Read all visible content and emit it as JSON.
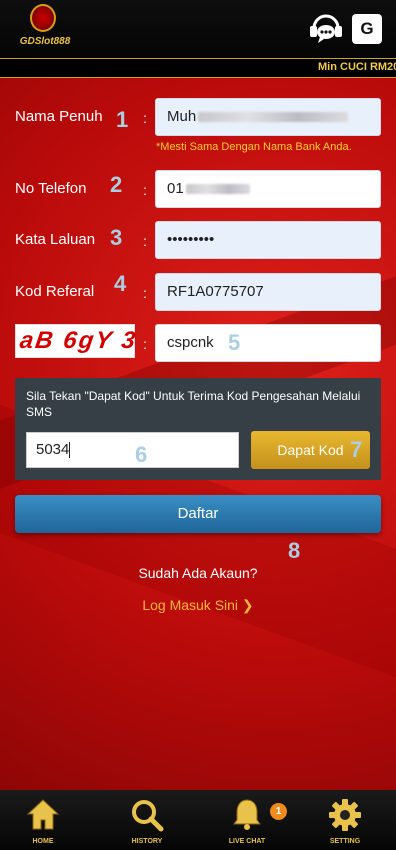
{
  "header": {
    "logo_text": "GDSlot888",
    "translate_label": "G",
    "ticker": "Min CUCI RM20"
  },
  "form": {
    "full_name": {
      "label": "Nama Penuh",
      "step": "1",
      "value": "Muh",
      "hint": "*Mesti Sama Dengan Nama Bank Anda."
    },
    "phone": {
      "label": "No Telefon",
      "step": "2",
      "value": "01"
    },
    "password": {
      "label": "Kata Laluan",
      "step": "3",
      "value": "•••••••••"
    },
    "referral": {
      "label": "Kod Referal",
      "step": "4",
      "value": "RF1A0775707"
    },
    "captcha": {
      "image_text": "aB 6gY 3",
      "step": "5",
      "value": "cspcnk"
    },
    "colon": ":"
  },
  "sms": {
    "instruction": "Sila Tekan \"Dapat Kod\" Untuk Terima Kod Pengesahan Melalui SMS",
    "code_value": "5034",
    "code_step": "6",
    "get_code_label": "Dapat Kod",
    "get_code_step": "7"
  },
  "register": {
    "label": "Daftar",
    "step": "8"
  },
  "footer_links": {
    "have_account": "Sudah Ada Akaun?",
    "login": "Log Masuk Sini ❯"
  },
  "bottom_nav": {
    "home": "HOME",
    "history": "HISTORY",
    "live_chat": "LIVE CHAT",
    "live_chat_badge": "1",
    "setting": "SETTING"
  },
  "colors": {
    "primary_red": "#b80a0a",
    "gold": "#e8c24a",
    "hint_yellow": "#ffcc33",
    "register_blue": "#2a7db5",
    "step_number": "#a9cfe0"
  }
}
